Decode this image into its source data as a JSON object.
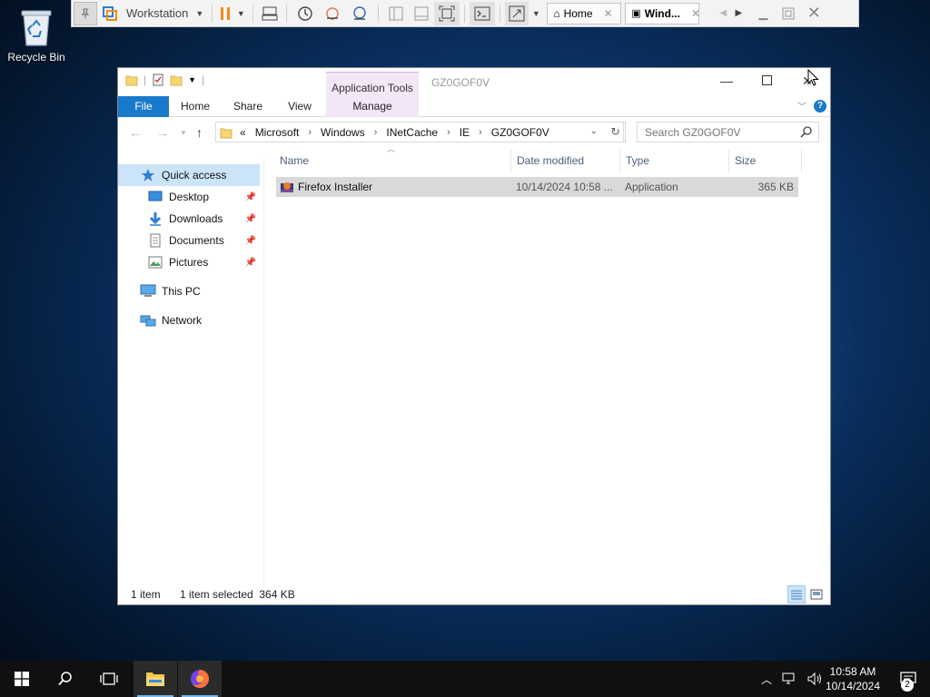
{
  "desktop": {
    "recycle_bin_label": "Recycle Bin"
  },
  "vmware": {
    "vm_name": "Workstation",
    "tabs": [
      {
        "label": "Home"
      },
      {
        "label": "Wind..."
      }
    ]
  },
  "explorer": {
    "title": "GZ0GOF0V",
    "context_tab_title": "Application Tools",
    "ribbon_tabs": [
      "File",
      "Home",
      "Share",
      "View",
      "Manage"
    ],
    "address": {
      "overflow": "«",
      "crumbs": [
        "Microsoft",
        "Windows",
        "INetCache",
        "IE",
        "GZ0GOF0V"
      ]
    },
    "search": {
      "placeholder": "Search GZ0GOF0V"
    },
    "nav": [
      {
        "label": "Quick access"
      },
      {
        "label": "Desktop"
      },
      {
        "label": "Downloads"
      },
      {
        "label": "Documents"
      },
      {
        "label": "Pictures"
      },
      {
        "label": "This PC"
      },
      {
        "label": "Network"
      }
    ],
    "columns": [
      "Name",
      "Date modified",
      "Type",
      "Size"
    ],
    "files": [
      {
        "name": "Firefox Installer",
        "date": "10/14/2024 10:58 ...",
        "type": "Application",
        "size": "365 KB"
      }
    ],
    "status": {
      "count": "1 item",
      "selection": "1 item selected  364 KB"
    }
  },
  "taskbar": {
    "time": "10:58 AM",
    "date": "10/14/2024",
    "notification_count": "2"
  },
  "colors": {
    "accent": "#1979ca",
    "selection": "#cce4f7",
    "context_tab": "#f3e6f6",
    "taskbar": "#101010"
  }
}
